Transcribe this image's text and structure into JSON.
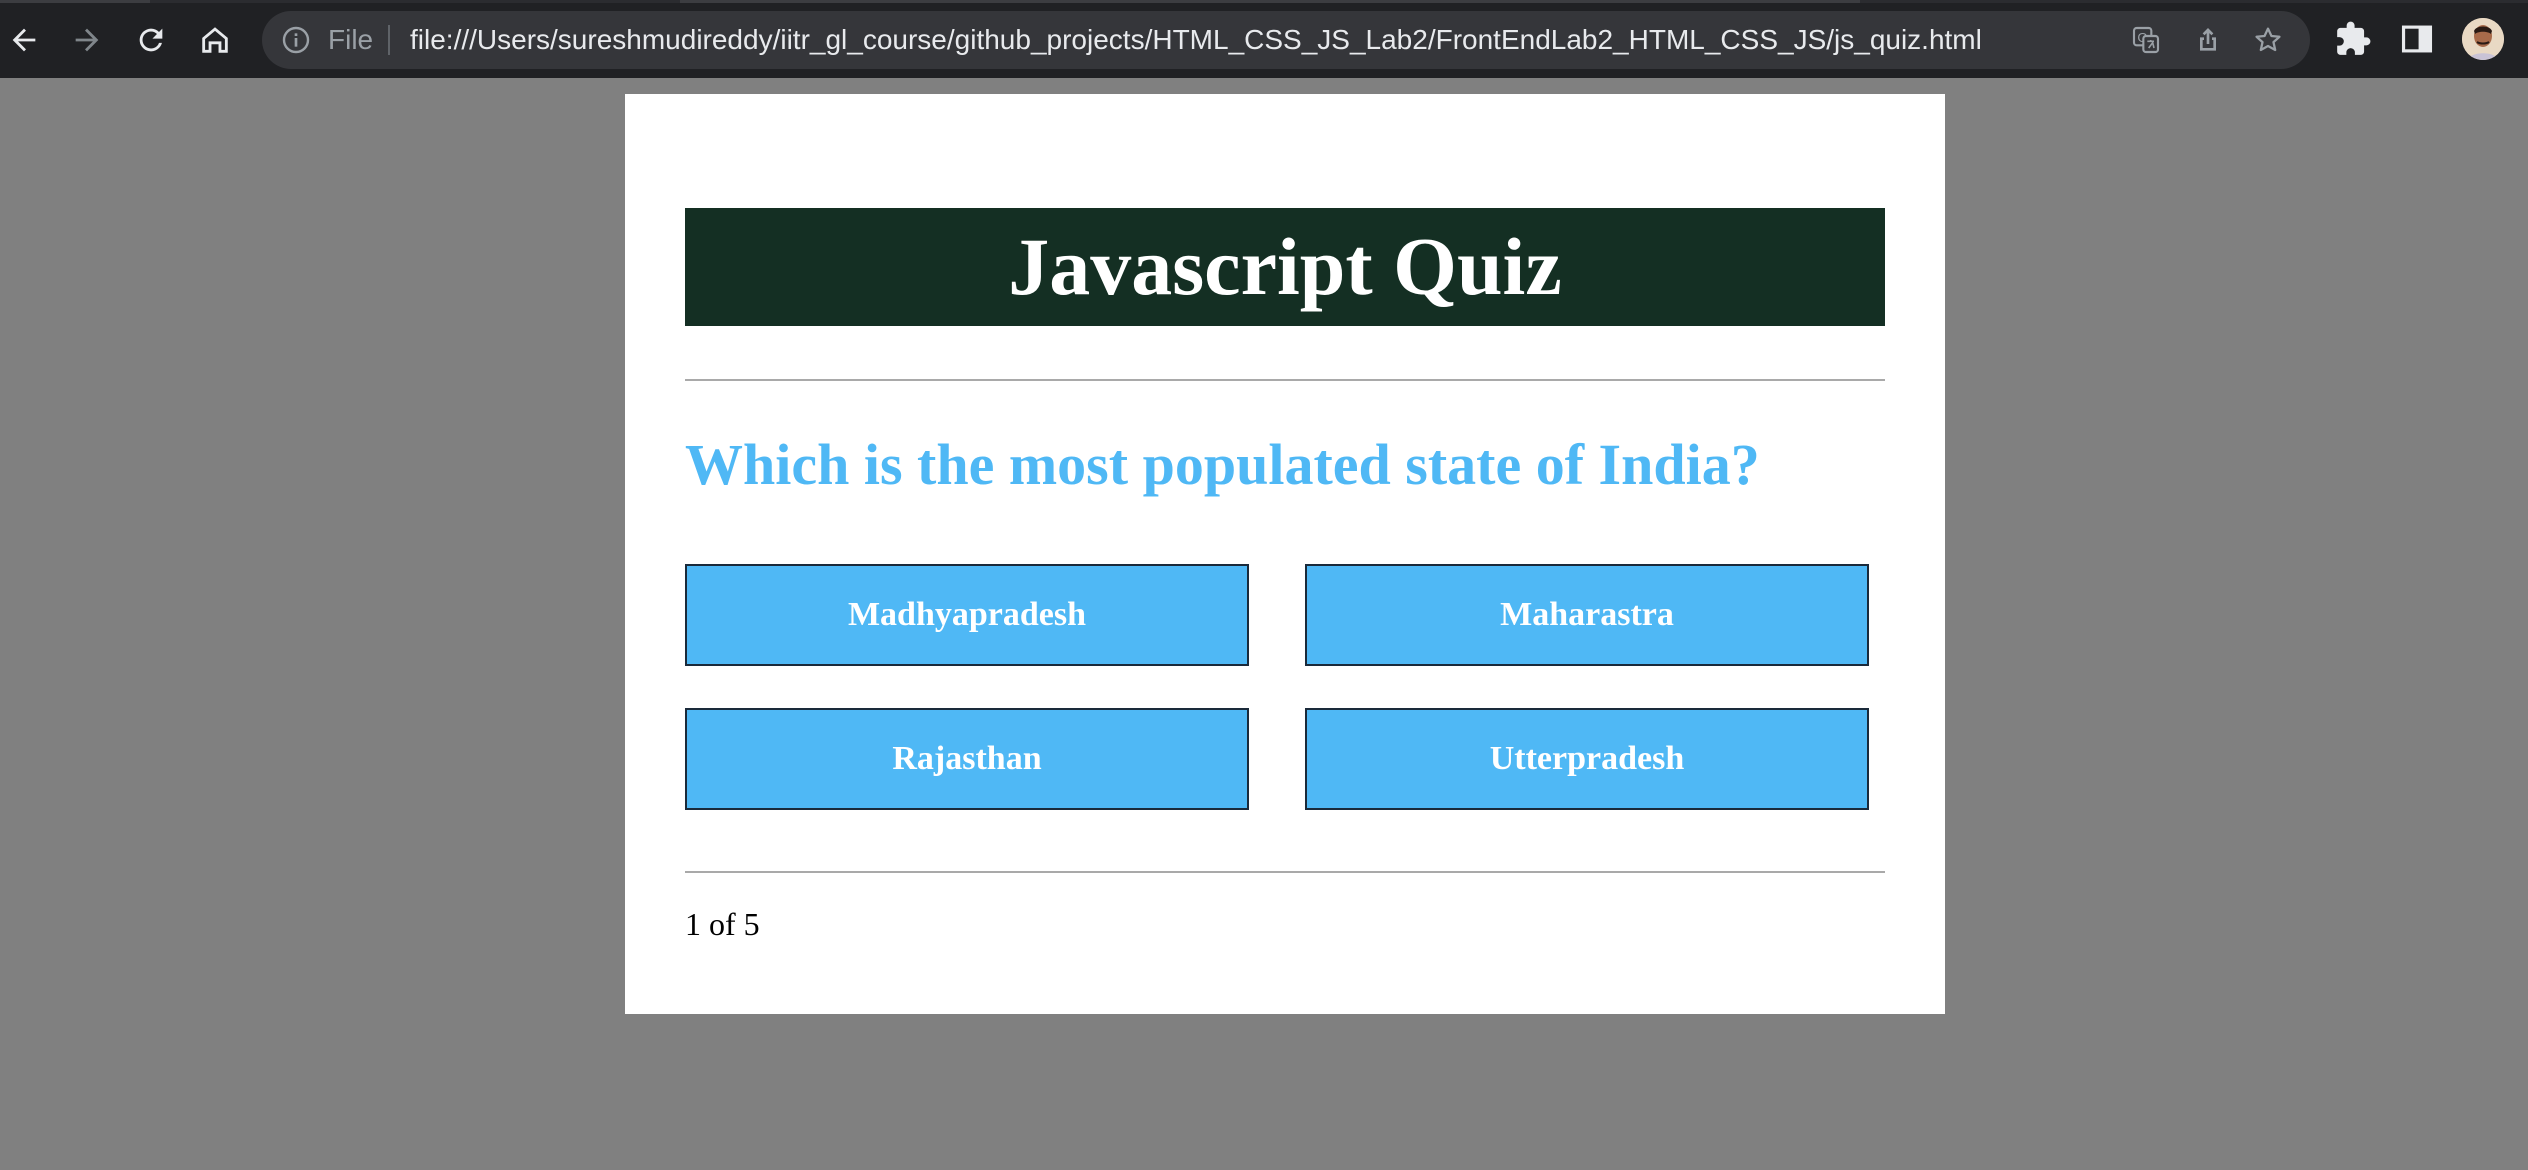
{
  "browser": {
    "file_label": "File",
    "url": "file:///Users/sureshmudireddy/iitr_gl_course/github_projects/HTML_CSS_JS_Lab2/FrontEndLab2_HTML_CSS_JS/js_quiz.html",
    "icons": {
      "back": "arrow-left",
      "forward": "arrow-right",
      "reload": "reload",
      "home": "home",
      "info": "info",
      "translate": "translate",
      "share": "share",
      "bookmark": "star",
      "extensions": "puzzle",
      "side_panel": "side-panel",
      "profile": "avatar"
    },
    "colors": {
      "chrome_bg": "#202124",
      "omnibox_bg": "#35363a",
      "url_text": "#e8eaed",
      "muted": "#9aa0a6"
    }
  },
  "quiz": {
    "title": "Javascript Quiz",
    "question": "Which is the most populated state of India?",
    "choices": [
      "Madhyapradesh",
      "Maharastra",
      "Rajasthan",
      "Utterpradesh"
    ],
    "progress": "1 of 5",
    "colors": {
      "page_bg": "#808080",
      "card_bg": "#ffffff",
      "header_bg": "#142f23",
      "accent": "#4fb8f5",
      "choice_text": "#ffffff"
    }
  }
}
